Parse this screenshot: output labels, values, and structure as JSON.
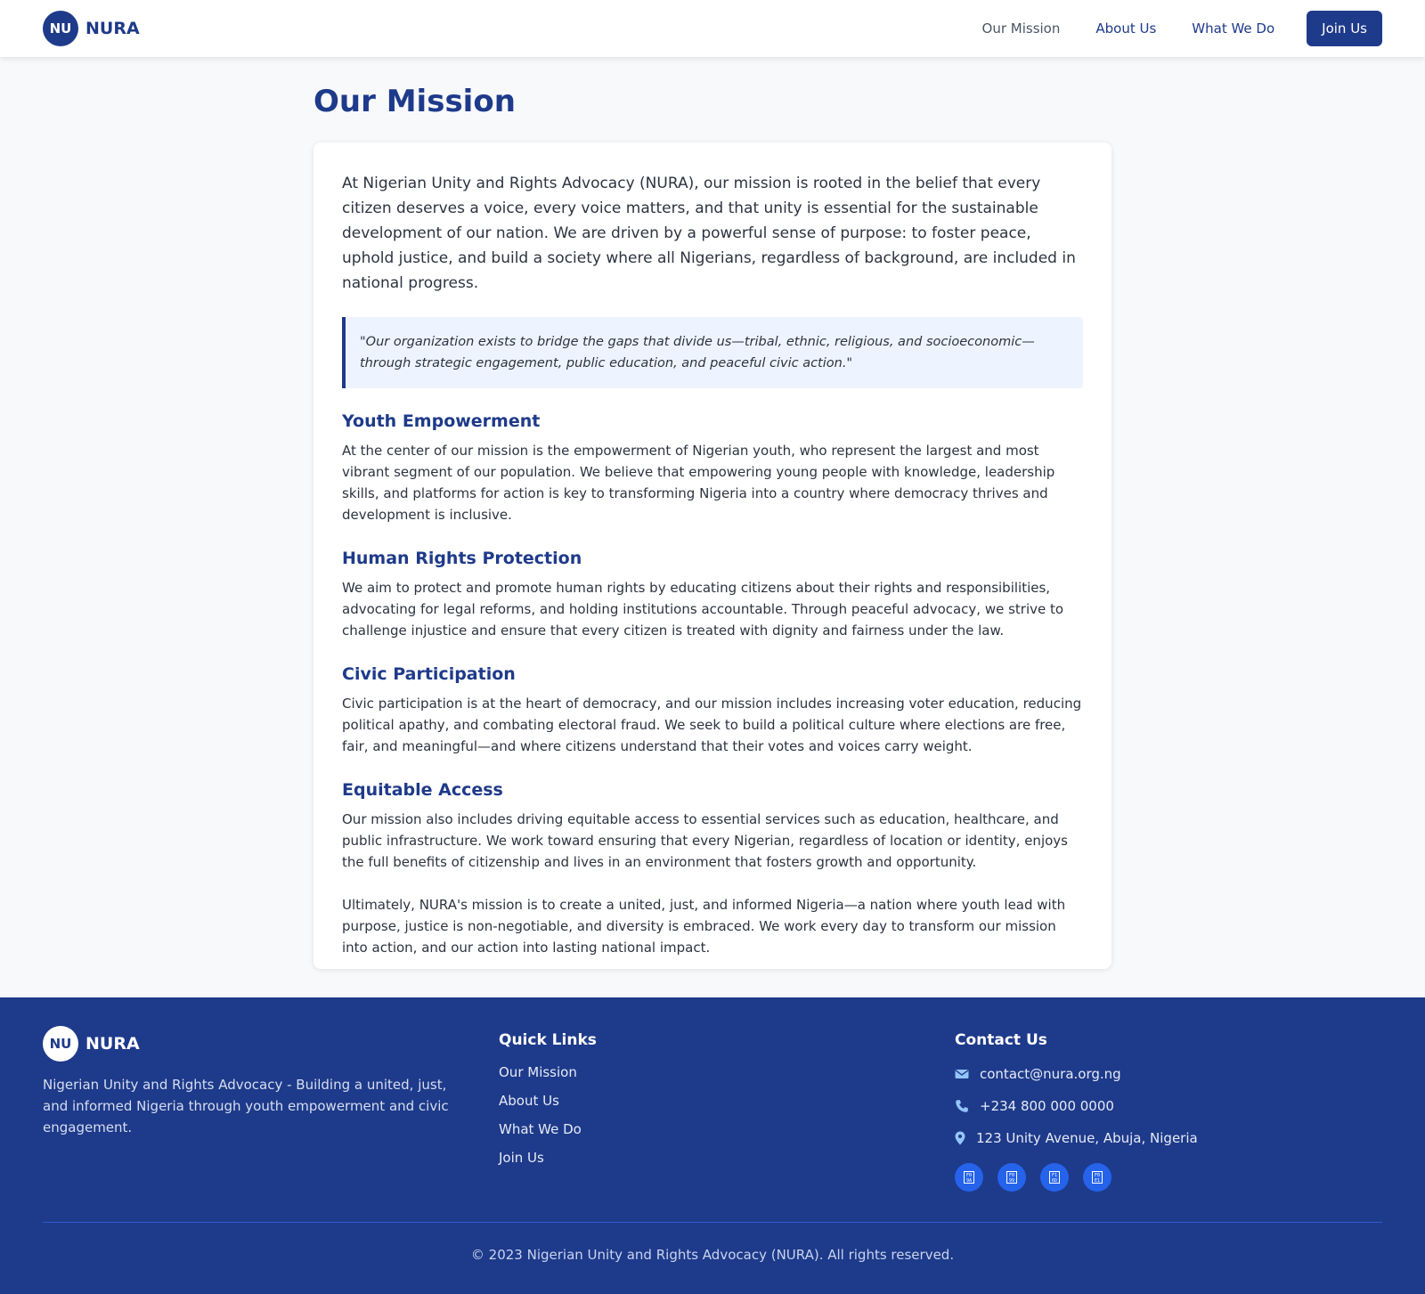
{
  "header": {
    "logo_text": "NU",
    "brand": "NURA",
    "nav": [
      {
        "label": "Our Mission"
      },
      {
        "label": "About Us"
      },
      {
        "label": "What We Do"
      }
    ],
    "cta": "Join Us"
  },
  "main": {
    "title": "Our Mission",
    "intro": "At Nigerian Unity and Rights Advocacy (NURA), our mission is rooted in the belief that every citizen deserves a voice, every voice matters, and that unity is essential for the sustainable development of our nation. We are driven by a powerful sense of purpose: to foster peace, uphold justice, and build a society where all Nigerians, regardless of background, are included in national progress.",
    "quote": "\"Our organization exists to bridge the gaps that divide us—tribal, ethnic, religious, and socioeconomic—through strategic engagement, public education, and peaceful civic action.\"",
    "sections": [
      {
        "heading": "Youth Empowerment",
        "text": "At the center of our mission is the empowerment of Nigerian youth, who represent the largest and most vibrant segment of our population. We believe that empowering young people with knowledge, leadership skills, and platforms for action is key to transforming Nigeria into a country where democracy thrives and development is inclusive."
      },
      {
        "heading": "Human Rights Protection",
        "text": "We aim to protect and promote human rights by educating citizens about their rights and responsibilities, advocating for legal reforms, and holding institutions accountable. Through peaceful advocacy, we strive to challenge injustice and ensure that every citizen is treated with dignity and fairness under the law."
      },
      {
        "heading": "Civic Participation",
        "text": "Civic participation is at the heart of democracy, and our mission includes increasing voter education, reducing political apathy, and combating electoral fraud. We seek to build a political culture where elections are free, fair, and meaningful—and where citizens understand that their votes and voices carry weight."
      },
      {
        "heading": "Equitable Access",
        "text": "Our mission also includes driving equitable access to essential services such as education, healthcare, and public infrastructure. We work toward ensuring that every Nigerian, regardless of location or identity, enjoys the full benefits of citizenship and lives in an environment that fosters growth and opportunity."
      }
    ],
    "closing": "Ultimately, NURA's mission is to create a united, just, and informed Nigeria—a nation where youth lead with purpose, justice is non-negotiable, and diversity is embraced. We work every day to transform our mission into action, and our action into lasting national impact."
  },
  "footer": {
    "logo_text": "NU",
    "brand": "NURA",
    "description": "Nigerian Unity and Rights Advocacy - Building a united, just, and informed Nigeria through youth empowerment and civic engagement.",
    "quick_links_heading": "Quick Links",
    "quick_links": [
      "Our Mission",
      "About Us",
      "What We Do",
      "Join Us"
    ],
    "contact_heading": "Contact Us",
    "contact": {
      "email": "contact@nura.org.ng",
      "phone": "+234 800 000 0000",
      "address": "123 Unity Avenue, Abuja, Nigeria"
    },
    "socials": [
      {
        "icon": "facebook-icon",
        "glyph": "F0\n9A"
      },
      {
        "icon": "twitter-icon",
        "glyph": "F0\n99"
      },
      {
        "icon": "instagram-icon",
        "glyph": "F1\n6D"
      },
      {
        "icon": "linkedin-icon",
        "glyph": "F0\nE1"
      }
    ],
    "copyright": "© 2023 Nigerian Unity and Rights Advocacy (NURA). All rights reserved."
  },
  "colors": {
    "primary": "#1e3a8a",
    "accent": "#2563eb",
    "quote_bg": "#edf4ff",
    "page_bg": "#f8f9fb"
  }
}
